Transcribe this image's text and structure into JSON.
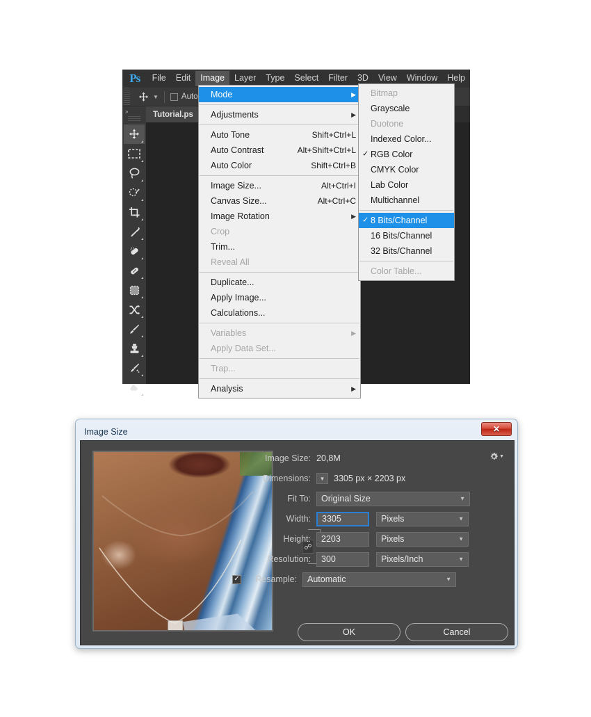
{
  "app": {
    "name": "Adobe Photoshop",
    "logo_text": "Ps",
    "menubar": [
      {
        "label": "File",
        "active": false
      },
      {
        "label": "Edit",
        "active": false
      },
      {
        "label": "Image",
        "active": true
      },
      {
        "label": "Layer",
        "active": false
      },
      {
        "label": "Type",
        "active": false
      },
      {
        "label": "Select",
        "active": false
      },
      {
        "label": "Filter",
        "active": false
      },
      {
        "label": "3D",
        "active": false
      },
      {
        "label": "View",
        "active": false
      },
      {
        "label": "Window",
        "active": false
      },
      {
        "label": "Help",
        "active": false
      }
    ],
    "options_bar": {
      "tool_icon": "move-tool-icon",
      "auto_select_label": "Auto",
      "auto_select_checked": false
    },
    "document_tab": {
      "label": "Tutorial.ps"
    },
    "toolbar": {
      "collapse_label": "»",
      "tools": [
        {
          "name": "move-tool",
          "selected": true
        },
        {
          "name": "rectangular-marquee-tool",
          "selected": false
        },
        {
          "name": "lasso-tool",
          "selected": false
        },
        {
          "name": "quick-selection-tool",
          "selected": false
        },
        {
          "name": "crop-tool",
          "selected": false
        },
        {
          "name": "eyedropper-tool",
          "selected": false
        },
        {
          "name": "spot-healing-brush-tool",
          "selected": false
        },
        {
          "name": "patch-tool",
          "selected": false
        },
        {
          "name": "content-aware-move-tool",
          "selected": false
        },
        {
          "name": "shuffle-tool",
          "selected": false
        },
        {
          "name": "brush-tool",
          "selected": false
        },
        {
          "name": "clone-stamp-tool",
          "selected": false
        },
        {
          "name": "history-brush-tool",
          "selected": false
        },
        {
          "name": "eraser-tool",
          "selected": false
        }
      ]
    }
  },
  "image_menu": {
    "items": [
      {
        "label": "Mode",
        "shortcut": "",
        "submenu": true,
        "highlighted": true,
        "disabled": false,
        "checked": false
      },
      {
        "separator": true
      },
      {
        "label": "Adjustments",
        "shortcut": "",
        "submenu": true,
        "highlighted": false,
        "disabled": false,
        "checked": false
      },
      {
        "separator": true
      },
      {
        "label": "Auto Tone",
        "shortcut": "Shift+Ctrl+L",
        "submenu": false,
        "highlighted": false,
        "disabled": false,
        "checked": false
      },
      {
        "label": "Auto Contrast",
        "shortcut": "Alt+Shift+Ctrl+L",
        "submenu": false,
        "highlighted": false,
        "disabled": false,
        "checked": false
      },
      {
        "label": "Auto Color",
        "shortcut": "Shift+Ctrl+B",
        "submenu": false,
        "highlighted": false,
        "disabled": false,
        "checked": false
      },
      {
        "separator": true
      },
      {
        "label": "Image Size...",
        "shortcut": "Alt+Ctrl+I",
        "submenu": false,
        "highlighted": false,
        "disabled": false,
        "checked": false
      },
      {
        "label": "Canvas Size...",
        "shortcut": "Alt+Ctrl+C",
        "submenu": false,
        "highlighted": false,
        "disabled": false,
        "checked": false
      },
      {
        "label": "Image Rotation",
        "shortcut": "",
        "submenu": true,
        "highlighted": false,
        "disabled": false,
        "checked": false
      },
      {
        "label": "Crop",
        "shortcut": "",
        "submenu": false,
        "highlighted": false,
        "disabled": true,
        "checked": false
      },
      {
        "label": "Trim...",
        "shortcut": "",
        "submenu": false,
        "highlighted": false,
        "disabled": false,
        "checked": false
      },
      {
        "label": "Reveal All",
        "shortcut": "",
        "submenu": false,
        "highlighted": false,
        "disabled": true,
        "checked": false
      },
      {
        "separator": true
      },
      {
        "label": "Duplicate...",
        "shortcut": "",
        "submenu": false,
        "highlighted": false,
        "disabled": false,
        "checked": false
      },
      {
        "label": "Apply Image...",
        "shortcut": "",
        "submenu": false,
        "highlighted": false,
        "disabled": false,
        "checked": false
      },
      {
        "label": "Calculations...",
        "shortcut": "",
        "submenu": false,
        "highlighted": false,
        "disabled": false,
        "checked": false
      },
      {
        "separator": true
      },
      {
        "label": "Variables",
        "shortcut": "",
        "submenu": true,
        "highlighted": false,
        "disabled": true,
        "checked": false
      },
      {
        "label": "Apply Data Set...",
        "shortcut": "",
        "submenu": false,
        "highlighted": false,
        "disabled": true,
        "checked": false
      },
      {
        "separator": true
      },
      {
        "label": "Trap...",
        "shortcut": "",
        "submenu": false,
        "highlighted": false,
        "disabled": true,
        "checked": false
      },
      {
        "separator": true
      },
      {
        "label": "Analysis",
        "shortcut": "",
        "submenu": true,
        "highlighted": false,
        "disabled": false,
        "checked": false
      }
    ]
  },
  "mode_submenu": {
    "items": [
      {
        "label": "Bitmap",
        "highlighted": false,
        "disabled": true,
        "checked": false
      },
      {
        "label": "Grayscale",
        "highlighted": false,
        "disabled": false,
        "checked": false
      },
      {
        "label": "Duotone",
        "highlighted": false,
        "disabled": true,
        "checked": false
      },
      {
        "label": "Indexed Color...",
        "highlighted": false,
        "disabled": false,
        "checked": false
      },
      {
        "label": "RGB Color",
        "highlighted": false,
        "disabled": false,
        "checked": true
      },
      {
        "label": "CMYK Color",
        "highlighted": false,
        "disabled": false,
        "checked": false
      },
      {
        "label": "Lab Color",
        "highlighted": false,
        "disabled": false,
        "checked": false
      },
      {
        "label": "Multichannel",
        "highlighted": false,
        "disabled": false,
        "checked": false
      },
      {
        "separator": true
      },
      {
        "label": "8 Bits/Channel",
        "highlighted": true,
        "disabled": false,
        "checked": true
      },
      {
        "label": "16 Bits/Channel",
        "highlighted": false,
        "disabled": false,
        "checked": false
      },
      {
        "label": "32 Bits/Channel",
        "highlighted": false,
        "disabled": false,
        "checked": false
      },
      {
        "separator": true
      },
      {
        "label": "Color Table...",
        "highlighted": false,
        "disabled": true,
        "checked": false
      }
    ]
  },
  "image_size_dialog": {
    "title": "Image Size",
    "close_label": "✕",
    "gear_icon": "gear-icon",
    "image_size_label": "Image Size:",
    "image_size_value": "20,8M",
    "dimensions_label": "Dimensions:",
    "dimensions_value": "3305 px  ×  2203 px",
    "fit_to_label": "Fit To:",
    "fit_to_value": "Original Size",
    "width_label": "Width:",
    "width_value": "3305",
    "width_unit": "Pixels",
    "height_label": "Height:",
    "height_value": "2203",
    "height_unit": "Pixels",
    "resolution_label": "Resolution:",
    "resolution_value": "300",
    "resolution_unit": "Pixels/Inch",
    "resample_label": "Resample:",
    "resample_value": "Automatic",
    "resample_checked": true,
    "constrain_icon": "chain-link-icon",
    "ok_label": "OK",
    "cancel_label": "Cancel"
  },
  "colors": {
    "menu_highlight": "#1e90e8",
    "ps_chrome": "#323232",
    "ps_panel": "#393939",
    "dialog_body": "#474747",
    "close_button": "#bd2414",
    "accent_focus": "#2a7fd4"
  }
}
